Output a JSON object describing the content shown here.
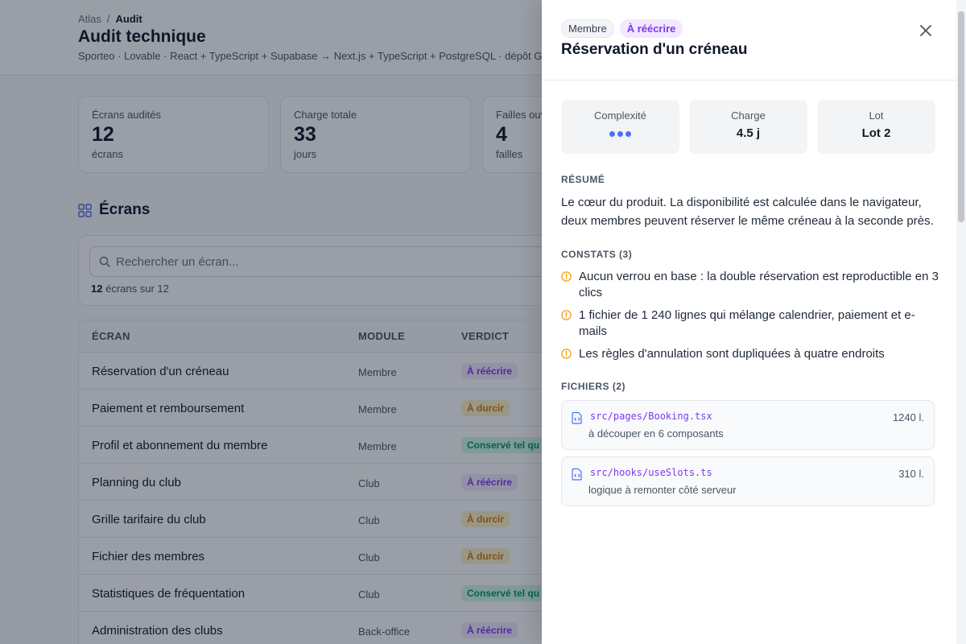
{
  "breadcrumb": {
    "root": "Atlas",
    "separator": "/",
    "current": "Audit"
  },
  "page": {
    "title": "Audit technique",
    "subtitle": "Sporteo · Lovable · React + TypeScript + Supabase → Next.js + TypeScript + PostgreSQL · dépôt GitH"
  },
  "stats": [
    {
      "label": "Écrans audités",
      "value": "12",
      "unit": "écrans"
    },
    {
      "label": "Charge totale",
      "value": "33",
      "unit": "jours"
    },
    {
      "label": "Failles ouv",
      "value": "4",
      "unit": "failles"
    }
  ],
  "screens_section": {
    "title": "Écrans"
  },
  "search": {
    "placeholder": "Rechercher un écran...",
    "count_value": "12",
    "count_suffix": "écrans sur 12"
  },
  "table": {
    "headers": {
      "screen": "ÉCRAN",
      "module": "MODULE",
      "verdict": "VERDICT"
    },
    "rows": [
      {
        "name": "Réservation d'un créneau",
        "module": "Membre",
        "verdict": "À réécrire",
        "kind": "rewrite"
      },
      {
        "name": "Paiement et remboursement",
        "module": "Membre",
        "verdict": "À durcir",
        "kind": "harden"
      },
      {
        "name": "Profil et abonnement du membre",
        "module": "Membre",
        "verdict": "Conservé tel qu",
        "kind": "keep"
      },
      {
        "name": "Planning du club",
        "module": "Club",
        "verdict": "À réécrire",
        "kind": "rewrite"
      },
      {
        "name": "Grille tarifaire du club",
        "module": "Club",
        "verdict": "À durcir",
        "kind": "harden"
      },
      {
        "name": "Fichier des membres",
        "module": "Club",
        "verdict": "À durcir",
        "kind": "harden"
      },
      {
        "name": "Statistiques de fréquentation",
        "module": "Club",
        "verdict": "Conservé tel qu",
        "kind": "keep"
      },
      {
        "name": "Administration des clubs",
        "module": "Back-office",
        "verdict": "À réécrire",
        "kind": "rewrite"
      }
    ]
  },
  "verdict_colors": {
    "rewrite": {
      "bg": "#f3e8ff",
      "fg": "#7c3aed"
    },
    "harden": {
      "bg": "#fef3c7",
      "fg": "#d97706"
    },
    "keep": {
      "bg": "#d1fae5",
      "fg": "#059669"
    }
  },
  "panel": {
    "module_tag": "Membre",
    "verdict_tag": "À réécrire",
    "title": "Réservation d'un créneau",
    "close_icon": "close-icon",
    "kpis": {
      "complexity_label": "Complexité",
      "complexity_level": 3,
      "charge_label": "Charge",
      "charge_value": "4.5 j",
      "lot_label": "Lot",
      "lot_value": "Lot 2"
    },
    "summary_heading": "RÉSUMÉ",
    "summary": "Le cœur du produit. La disponibilité est calculée dans le navigateur, deux membres peuvent réserver le même créneau à la seconde près.",
    "findings_heading": "CONSTATS (3)",
    "findings": [
      "Aucun verrou en base : la double réservation est reproductible en 3 clics",
      "1 fichier de 1 240 lignes qui mélange calendrier, paiement et e-mails",
      "Les règles d'annulation sont dupliquées à quatre endroits"
    ],
    "files_heading": "FICHIERS (2)",
    "files": [
      {
        "path": "src/pages/Booking.tsx",
        "lines": "1240 l.",
        "note": "à découper en 6 composants"
      },
      {
        "path": "src/hooks/useSlots.ts",
        "lines": "310 l.",
        "note": "logique à remonter côté serveur"
      }
    ]
  },
  "colors": {
    "accent": "#4f6ef7",
    "warning": "#f59e0b",
    "file_path": "#7c3aed"
  }
}
